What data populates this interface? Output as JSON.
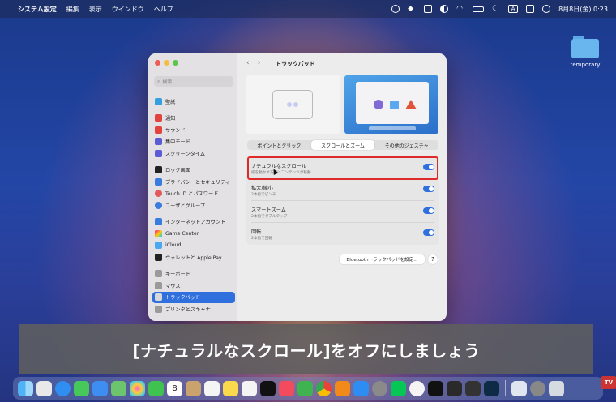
{
  "menubar": {
    "app_name": "システム設定",
    "menus": [
      "編集",
      "表示",
      "ウインドウ",
      "ヘルプ"
    ],
    "clock": "8月8日(金)  0:23",
    "input_mode": "A"
  },
  "desktop": {
    "folder_label": "temporary"
  },
  "window": {
    "title": "トラックパッド",
    "search_placeholder": "検索",
    "sidebar": [
      {
        "label": "壁紙",
        "color": "#34a0e0"
      },
      {
        "label": "通知",
        "color": "#e2433c"
      },
      {
        "label": "サウンド",
        "color": "#e2433c"
      },
      {
        "label": "集中モード",
        "color": "#5b5bd6"
      },
      {
        "label": "スクリーンタイム",
        "color": "#5b5bd6"
      },
      {
        "label": "ロック画面",
        "color": "#222222"
      },
      {
        "label": "プライバシーとセキュリティ",
        "color": "#3a7be0"
      },
      {
        "label": "Touch ID とパスワード",
        "color": "#e25a5a"
      },
      {
        "label": "ユーザとグループ",
        "color": "#3a7be0"
      },
      {
        "label": "インターネットアカウント",
        "color": "#3a7be0"
      },
      {
        "label": "Game Center",
        "color": "#e0e0e0"
      },
      {
        "label": "iCloud",
        "color": "#4aa8f0"
      },
      {
        "label": "ウォレットと Apple Pay",
        "color": "#222222"
      },
      {
        "label": "キーボード",
        "color": "#9a9a9a"
      },
      {
        "label": "マウス",
        "color": "#9a9a9a"
      },
      {
        "label": "トラックパッド",
        "color": "#9a9a9a"
      },
      {
        "label": "プリンタとスキャナ",
        "color": "#9a9a9a"
      }
    ],
    "active_sidebar_item": "トラックパッド",
    "tabs": [
      "ポイントとクリック",
      "スクロールとズーム",
      "その他のジェスチャ"
    ],
    "selected_tab": "スクロールとズーム",
    "settings": [
      {
        "title": "ナチュラルなスクロール",
        "subtitle": "指を動かす方向にコンテンツが移動",
        "on": true
      },
      {
        "title": "拡大/縮小",
        "subtitle": "2本指でピンチ",
        "on": true
      },
      {
        "title": "スマートズーム",
        "subtitle": "2本指でダブルタップ",
        "on": true
      },
      {
        "title": "回転",
        "subtitle": "2本指で回転",
        "on": true
      }
    ],
    "bluetooth_button": "Bluetoothトラックパッドを設定...",
    "help_button": "?"
  },
  "subtitle": "[ナチュラルなスクロール]をオフにしましょう",
  "dock": {
    "apps": [
      "finder-icon",
      "launchpad-icon",
      "safari-icon",
      "messages-icon",
      "mail-icon",
      "maps-icon",
      "photos-icon",
      "facetime-icon",
      "calendar-icon",
      "contacts-icon",
      "reminders-icon",
      "notes-icon",
      "freeform-icon",
      "appletv-icon",
      "music-icon",
      "numbers-icon",
      "chrome-icon",
      "books-icon",
      "appstore-icon",
      "settings-icon",
      "line-icon",
      "chatgpt-icon",
      "capcut-icon",
      "davinci-icon",
      "calculator-icon",
      "photoshop-icon",
      "preview-icon",
      "quicktime-icon"
    ],
    "calendar_day": "8"
  },
  "corner_badge": "TV"
}
